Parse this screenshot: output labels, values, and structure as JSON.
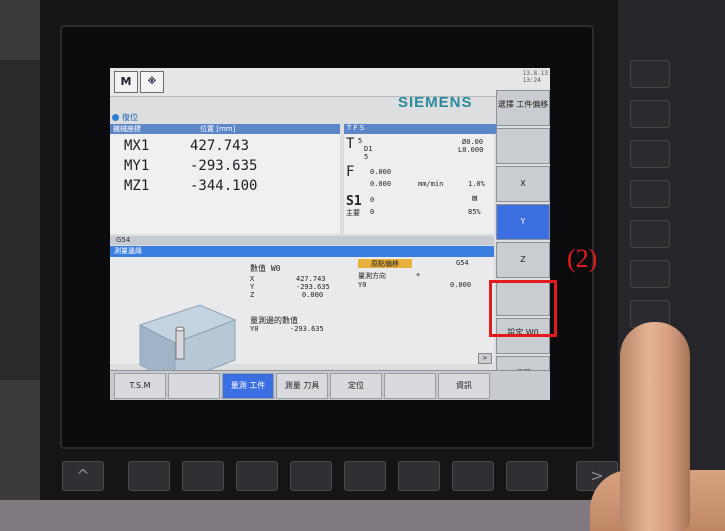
{
  "screen": {
    "brand": "SIEMENS",
    "clock_lines": [
      "13.8.13",
      "13:24"
    ],
    "mode_label": "復位",
    "position_panel": {
      "header_left": "機械座標",
      "header_right": "位置 [mm]",
      "axes": [
        {
          "name": "MX1",
          "value": "427.743"
        },
        {
          "name": "MY1",
          "value": "-293.635"
        },
        {
          "name": "MZ1",
          "value": "-344.100"
        }
      ]
    },
    "tfs_panel": {
      "header": "T F S",
      "t_label": "T",
      "t_value": "5",
      "d_value": "D1",
      "t_sub": "5",
      "dia": "Ø0.00",
      "len": "L0.000",
      "f_label": "F",
      "f_value1": "0.000",
      "f_value2": "0.000",
      "f_unit": "mm/min",
      "f_pct": "1.0%",
      "s_label": "S1",
      "s_value": "0",
      "spindle_label": "主要",
      "spindle_value": "0",
      "s_pct": "85%"
    },
    "wcs_label": "G54",
    "meas_title": "測量邊緣",
    "meas": {
      "zero_label": "數值 W0",
      "rows": [
        {
          "axis": "X",
          "value": "427.743"
        },
        {
          "axis": "Y",
          "value": "-293.635"
        },
        {
          "axis": "Z",
          "value": "0.000"
        }
      ],
      "mode_badge": "原點偏移",
      "offset_name": "G54",
      "direction_label": "量測方向",
      "direction_sign": "+",
      "y0_label": "Y0",
      "y0_value": "0.000",
      "result_title": "量測邊的數值",
      "result_axis": "Y0",
      "result_value": "-293.635"
    },
    "vertical_softkeys": [
      {
        "label": "選擇 工件偏移",
        "active": false
      },
      {
        "label": "",
        "active": false
      },
      {
        "label": "X",
        "active": false
      },
      {
        "label": "Y",
        "active": true
      },
      {
        "label": "Z",
        "active": false
      },
      {
        "label": "",
        "active": false
      },
      {
        "label": "設定 W0",
        "active": false
      },
      {
        "label": "返回",
        "active": false
      }
    ],
    "horizontal_softkeys": [
      {
        "label": "T.S.M",
        "active": false
      },
      {
        "label": "",
        "active": false
      },
      {
        "label": "量測 工件",
        "active": true
      },
      {
        "label": "測量 刀具",
        "active": false
      },
      {
        "label": "定位",
        "active": false
      },
      {
        "label": "",
        "active": false
      },
      {
        "label": "",
        "active": false
      },
      {
        "label": "資訊",
        "active": false
      }
    ]
  },
  "annotation": {
    "label": "(2)",
    "color": "#e21c1c"
  },
  "colors": {
    "screen_bg": "#dcdedf",
    "highlight_blue": "#3a7ee0",
    "brand_teal": "#2a8a9e"
  }
}
